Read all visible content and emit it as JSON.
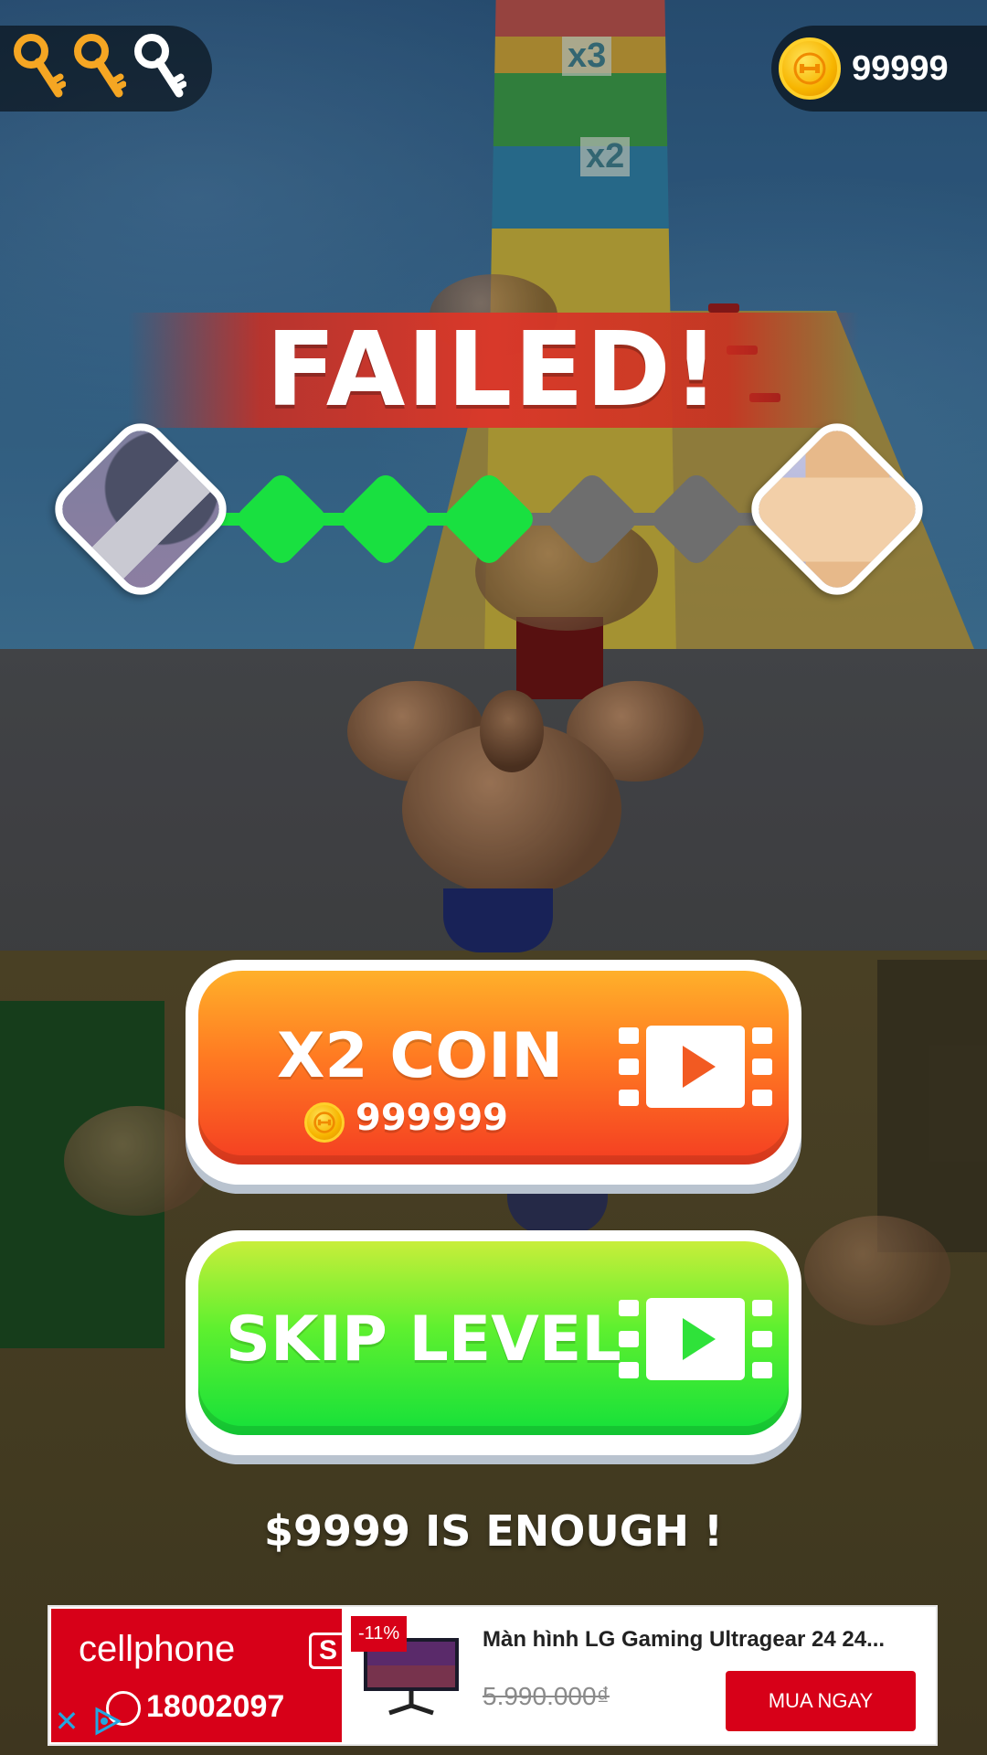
{
  "hud": {
    "keys": [
      {
        "state": "collected",
        "color": "#f5a623",
        "icon": "key-icon"
      },
      {
        "state": "collected",
        "color": "#f5a623",
        "icon": "key-icon"
      },
      {
        "state": "empty",
        "color": "#ffffff",
        "icon": "key-icon"
      }
    ],
    "coins": "99999",
    "coin_icon": "dumbbell-coin-icon"
  },
  "background_signs": {
    "sign_1": "x3",
    "sign_2": "x2"
  },
  "result": {
    "title": "FAILED!"
  },
  "progress": {
    "total_stages": 5,
    "completed_stages": 3,
    "completed_color": "#19e040",
    "pending_color": "#6e6e6e"
  },
  "buttons": {
    "x2_coin": {
      "label": "X2 COIN",
      "amount": "999999",
      "icon": "video-ad-icon"
    },
    "skip_level": {
      "label": "SKIP LEVEL",
      "icon": "video-ad-icon"
    }
  },
  "message": "$9999 IS ENOUGH !",
  "ad": {
    "brand": "cellphone",
    "brand_badge": "S",
    "phone": "18002097",
    "discount": "-11%",
    "title": "Màn hình LG Gaming Ultragear 24 24...",
    "old_price": "5.990.000₫",
    "cta": "MUA NGAY",
    "close_symbol": "✕"
  }
}
